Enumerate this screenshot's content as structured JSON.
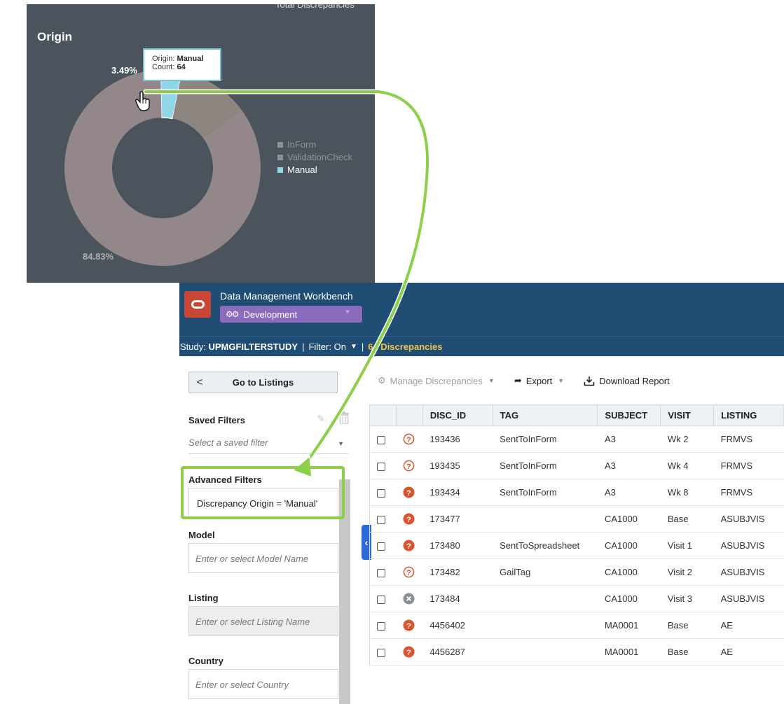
{
  "chart_panel": {
    "cut_title": "Total Discrepancies",
    "title": "Origin",
    "tooltip": {
      "origin_label": "Origin:",
      "origin_value": "Manual",
      "count_label": "Count:",
      "count_value": "64"
    },
    "legend": [
      "InForm",
      "ValidationCheck",
      "Manual"
    ],
    "colors": {
      "inform": "#8c8580",
      "validation_check": "#93878a",
      "manual": "#8fd6e6",
      "background": "#4b545c"
    }
  },
  "chart_data": {
    "type": "pie",
    "title": "Origin",
    "categories": [
      "InForm",
      "ValidationCheck",
      "Manual"
    ],
    "values": [
      11.68,
      84.83,
      3.49
    ],
    "data_labels": [
      "",
      "84.83%",
      "3.49%"
    ],
    "legend": "right"
  },
  "app": {
    "title": "Data Management Workbench",
    "environment": "Development",
    "study_label": "Study:",
    "study_name": "UPMGFILTERSTUDY",
    "filter_label": "Filter:",
    "filter_value": "On",
    "discrepancy_count": "64 Discrepancies",
    "colors": {
      "header": "#1f4d73",
      "logo": "#c74634",
      "env": "#8c6bbf",
      "accent": "#f0c248"
    }
  },
  "sidebar": {
    "go_to_listings": "Go to Listings",
    "saved_filters_label": "Saved Filters",
    "saved_filter_placeholder": "Select a saved filter",
    "advanced_filters_label": "Advanced Filters",
    "advanced_filter_value": "Discrepancy Origin = 'Manual'",
    "model_label": "Model",
    "model_placeholder": "Enter or select Model Name",
    "listing_label": "Listing",
    "listing_placeholder": "Enter or select Listing Name",
    "country_label": "Country",
    "country_placeholder": "Enter or select Country"
  },
  "toolbar": {
    "manage": "Manage Discrepancies",
    "export": "Export",
    "download": "Download Report"
  },
  "table": {
    "columns": [
      "",
      "",
      "DISC_ID",
      "TAG",
      "SUBJECT",
      "VISIT",
      "LISTING"
    ],
    "rows": [
      {
        "status": "question-outline",
        "disc_id": "193436",
        "tag": "SentToInForm",
        "subject": "A3",
        "visit": "Wk 2",
        "listing": "FRMVS"
      },
      {
        "status": "question-outline",
        "disc_id": "193435",
        "tag": "SentToInForm",
        "subject": "A3",
        "visit": "Wk 4",
        "listing": "FRMVS"
      },
      {
        "status": "question-filled",
        "disc_id": "193434",
        "tag": "SentToInForm",
        "subject": "A3",
        "visit": "Wk 8",
        "listing": "FRMVS"
      },
      {
        "status": "question-filled",
        "disc_id": "173477",
        "tag": "",
        "subject": "CA1000",
        "visit": "Base",
        "listing": "ASUBJVIS"
      },
      {
        "status": "question-filled",
        "disc_id": "173480",
        "tag": "SentToSpreadsheet",
        "subject": "CA1000",
        "visit": "Visit 1",
        "listing": "ASUBJVIS"
      },
      {
        "status": "question-outline",
        "disc_id": "173482",
        "tag": "GailTag",
        "subject": "CA1000",
        "visit": "Visit 2",
        "listing": "ASUBJVIS"
      },
      {
        "status": "closed",
        "disc_id": "173484",
        "tag": "",
        "subject": "CA1000",
        "visit": "Visit 3",
        "listing": "ASUBJVIS"
      },
      {
        "status": "question-filled",
        "disc_id": "4456402",
        "tag": "",
        "subject": "MA0001",
        "visit": "Base",
        "listing": "AE"
      },
      {
        "status": "question-filled",
        "disc_id": "4456287",
        "tag": "",
        "subject": "MA0001",
        "visit": "Base",
        "listing": "AE"
      }
    ]
  }
}
